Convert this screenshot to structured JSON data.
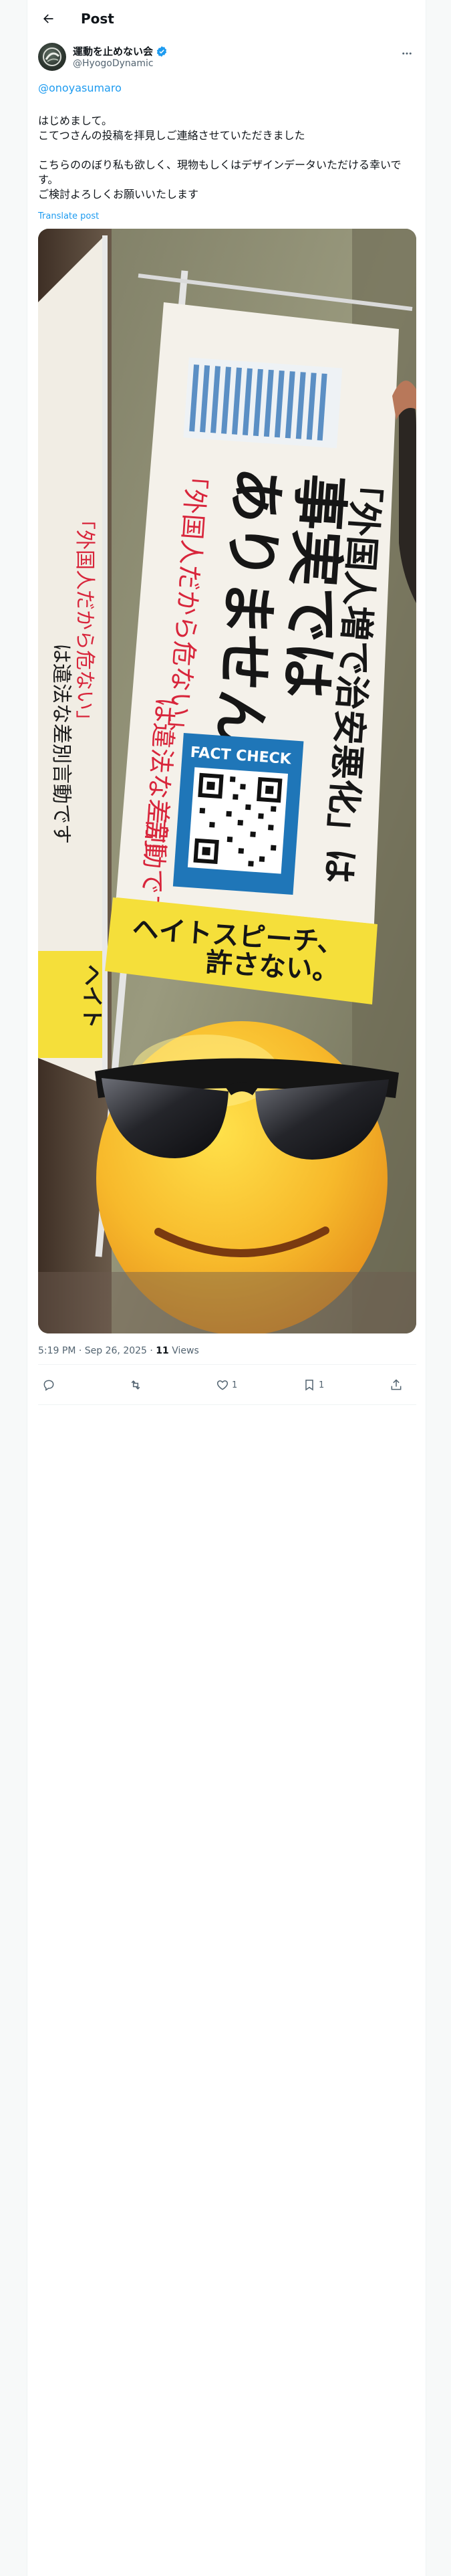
{
  "header": {
    "title": "Post",
    "back_icon": "arrow-left-icon"
  },
  "author": {
    "name": "運動を止めない会",
    "handle": "@HyogoDynamic",
    "verified": true,
    "verified_color": "#1d9bf0"
  },
  "post": {
    "mention": "@onoyasumaro",
    "lines": [
      "はじめまして。",
      "こてつさんの投稿を拝見しご連絡させていただきました",
      "",
      "こちらののぼり私も欲しく、現物もしくはデザインデータいただける幸いです。",
      "ご検討よろしくお願いいたします"
    ],
    "translate": "Translate post"
  },
  "photo": {
    "banner_main": [
      "「外国人増で治安悪化」は",
      "事実では",
      "ありません。"
    ],
    "banner_red": [
      "「外国人だから危ない」",
      "は違法な差別",
      "言動です。"
    ],
    "banner_red_alt": "は違法な差別言動です。",
    "fact_check": "FACT CHECK",
    "footer": [
      "ヘイトスピーチ、",
      "許さない。"
    ],
    "left_banner_red": "「外国人だから危ない」",
    "left_banner_black": "は違法な差別言動です",
    "left_banner_yellow": "ヘイト"
  },
  "meta": {
    "time": "5:19 PM · Sep 26, 2025 · ",
    "views_count": "11",
    "views_label": " Views"
  },
  "actions": {
    "reply_count": "",
    "repost_count": "",
    "like_count": "1",
    "bookmark_count": "1"
  },
  "colors": {
    "link": "#1d9bf0",
    "muted": "#536471",
    "banner_blue": "#1f76b8",
    "banner_red": "#d8253b",
    "banner_yellow": "#f5df3a"
  }
}
